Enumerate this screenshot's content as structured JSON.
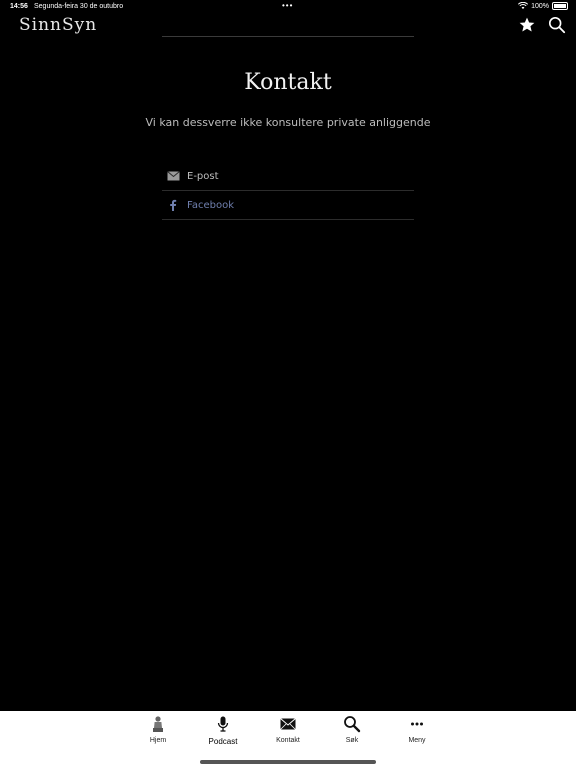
{
  "status_bar": {
    "time": "14:56",
    "date": "Segunda-feira 30 de outubro",
    "dots": "•••",
    "battery": "100%"
  },
  "header": {
    "logo_text": "SinnSyn"
  },
  "main": {
    "title": "Kontakt",
    "subtitle": "Vi kan dessverre ikke konsultere private anliggende",
    "contacts": [
      {
        "label": "E-post",
        "icon": "mail-icon"
      },
      {
        "label": "Facebook",
        "icon": "facebook-icon"
      }
    ]
  },
  "tab_bar": {
    "tabs": [
      {
        "label": "Hjem",
        "icon": "statue-icon"
      },
      {
        "label": "Podcast",
        "icon": "microphone-icon"
      },
      {
        "label": "Kontakt",
        "icon": "mail-icon"
      },
      {
        "label": "Søk",
        "icon": "search-icon"
      },
      {
        "label": "Meny",
        "icon": "more-icon"
      }
    ]
  },
  "colors": {
    "background": "#000000",
    "facebook_link": "#6f7fae",
    "tab_bar": "#ffffff"
  }
}
